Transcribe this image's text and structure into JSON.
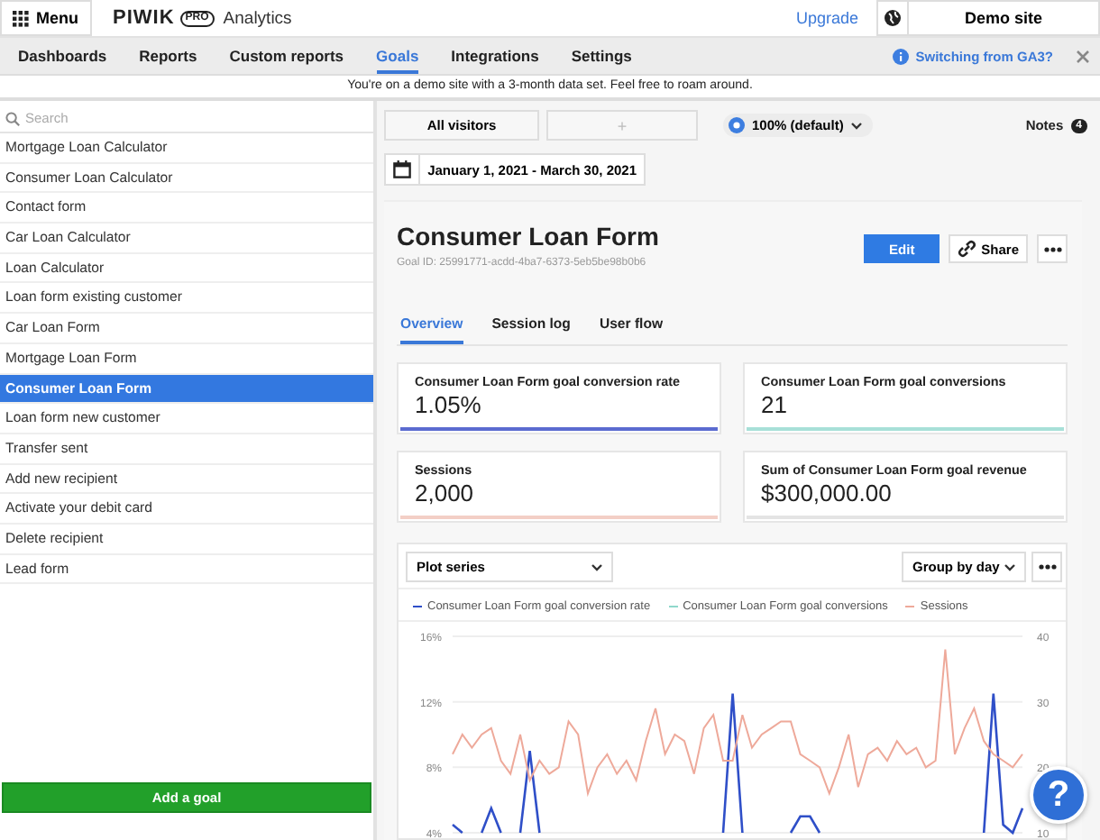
{
  "topbar": {
    "menu_button": "Menu",
    "logo": {
      "name": "PIWIK",
      "badge": "PRO",
      "product": "Analytics"
    },
    "upgrade_link": "Upgrade",
    "site_selector": "Demo site"
  },
  "nav": {
    "tabs": [
      {
        "label": "Dashboards",
        "selected": false
      },
      {
        "label": "Reports",
        "selected": false
      },
      {
        "label": "Custom reports",
        "selected": false
      },
      {
        "label": "Goals",
        "selected": true
      },
      {
        "label": "Integrations",
        "selected": false
      },
      {
        "label": "Settings",
        "selected": false
      }
    ],
    "info_link": "Switching from GA3?"
  },
  "banner": "You're on a demo site with a 3-month data set. Feel free to roam around.",
  "sidebar": {
    "search": {
      "placeholder": "Search"
    },
    "items": [
      {
        "label": "Mortgage Loan Calculator",
        "selected": false
      },
      {
        "label": "Consumer Loan Calculator",
        "selected": false
      },
      {
        "label": "Contact form",
        "selected": false
      },
      {
        "label": "Car Loan Calculator",
        "selected": false
      },
      {
        "label": "Loan Calculator",
        "selected": false
      },
      {
        "label": "Loan form existing customer",
        "selected": false
      },
      {
        "label": "Car Loan Form",
        "selected": false
      },
      {
        "label": "Mortgage Loan Form",
        "selected": false
      },
      {
        "label": "Consumer Loan Form",
        "selected": true
      },
      {
        "label": "Loan form new customer",
        "selected": false
      },
      {
        "label": "Transfer sent",
        "selected": false
      },
      {
        "label": "Add new recipient",
        "selected": false
      },
      {
        "label": "Activate your debit card",
        "selected": false
      },
      {
        "label": "Delete recipient",
        "selected": false
      },
      {
        "label": "Lead form",
        "selected": false
      }
    ],
    "add_button": "Add a goal"
  },
  "toolbar": {
    "segment_button": "All visitors",
    "add_segment_button": "+",
    "sampling": "100% (default)",
    "notes": {
      "label": "Notes",
      "count": "4"
    },
    "date_range": "January 1, 2021 - March 30, 2021"
  },
  "goal": {
    "title": "Consumer Loan Form",
    "goal_id": "Goal ID: 25991771-acdd-4ba7-6373-5eb5be98b0b6",
    "buttons": {
      "edit": "Edit",
      "share": "Share"
    },
    "tabs": [
      {
        "label": "Overview",
        "selected": true
      },
      {
        "label": "Session log",
        "selected": false
      },
      {
        "label": "User flow",
        "selected": false
      }
    ],
    "kpis": [
      {
        "label": "Consumer Loan Form goal conversion rate",
        "value": "1.05%",
        "color": "#5b6bd0"
      },
      {
        "label": "Consumer Loan Form goal conversions",
        "value": "21",
        "color": "#a8e0d8"
      },
      {
        "label": "Sessions",
        "value": "2,000",
        "color": "#f3cfc6"
      },
      {
        "label": "Sum of Consumer Loan Form goal revenue",
        "value": "$300,000.00",
        "color": "#e4e4e4"
      }
    ],
    "chart_panel": {
      "plot_series": "Plot series",
      "group_by": "Group by day",
      "right_axis_ticks": [
        "40",
        "30",
        "20",
        "10"
      ],
      "chart_data": {
        "type": "line",
        "grid": true,
        "ylim": [
          4,
          16
        ],
        "yticks": [
          {
            "value": 16,
            "label": "16%"
          },
          {
            "value": 12,
            "label": "12%"
          },
          {
            "value": 8,
            "label": "8%"
          },
          {
            "value": 4,
            "label": "4%"
          }
        ],
        "series": [
          {
            "name": "Consumer Loan Form goal conversion rate",
            "color": "#2f4fc8",
            "values": [
              4.5,
              4,
              null,
              4,
              5.5,
              4,
              null,
              4,
              9,
              4,
              null,
              null,
              null,
              null,
              null,
              null,
              null,
              null,
              null,
              null,
              null,
              null,
              null,
              null,
              null,
              null,
              null,
              null,
              4,
              12.5,
              4,
              null,
              null,
              null,
              null,
              4,
              5,
              5,
              4,
              null,
              null,
              null,
              null,
              null,
              null,
              null,
              null,
              null,
              null,
              null,
              null,
              null,
              null,
              null,
              null,
              4,
              12.5,
              4.5,
              4,
              5.5
            ]
          },
          {
            "name": "Consumer Loan Form goal conversions",
            "color": "#8fd8cc",
            "values": [
              null,
              null,
              null,
              null,
              null,
              null,
              null,
              null,
              null,
              null,
              null,
              null,
              null,
              null,
              null,
              null,
              null,
              null,
              null,
              null,
              null,
              null,
              null,
              null,
              null,
              null,
              null,
              null,
              null,
              null,
              null,
              null,
              null,
              null,
              null,
              null,
              null,
              null,
              null,
              null,
              null,
              null,
              null,
              null,
              null,
              null,
              null,
              null,
              null,
              null,
              null,
              null,
              null,
              null,
              null,
              null,
              null,
              null,
              null,
              null
            ]
          },
          {
            "name": "Sessions",
            "color": "#eea99a",
            "values": [
              8.8,
              10,
              9.2,
              10,
              10.4,
              8.4,
              7.6,
              10,
              7.2,
              8.4,
              7.6,
              8,
              10.8,
              10,
              6.4,
              8,
              8.8,
              7.6,
              8.4,
              7.2,
              9.6,
              11.6,
              8.8,
              10,
              9.6,
              7.6,
              10.4,
              11.2,
              8.4,
              8.4,
              11.2,
              9.2,
              10,
              10.4,
              10.8,
              10.8,
              8.8,
              8.4,
              8,
              6.4,
              8,
              10,
              6.8,
              8.8,
              9.2,
              8.4,
              9.6,
              8.8,
              9.2,
              8,
              8.4,
              15.2,
              8.8,
              10.4,
              11.6,
              9.6,
              8.8,
              8.4,
              8,
              8.8
            ]
          }
        ]
      }
    }
  },
  "help_button": "?"
}
